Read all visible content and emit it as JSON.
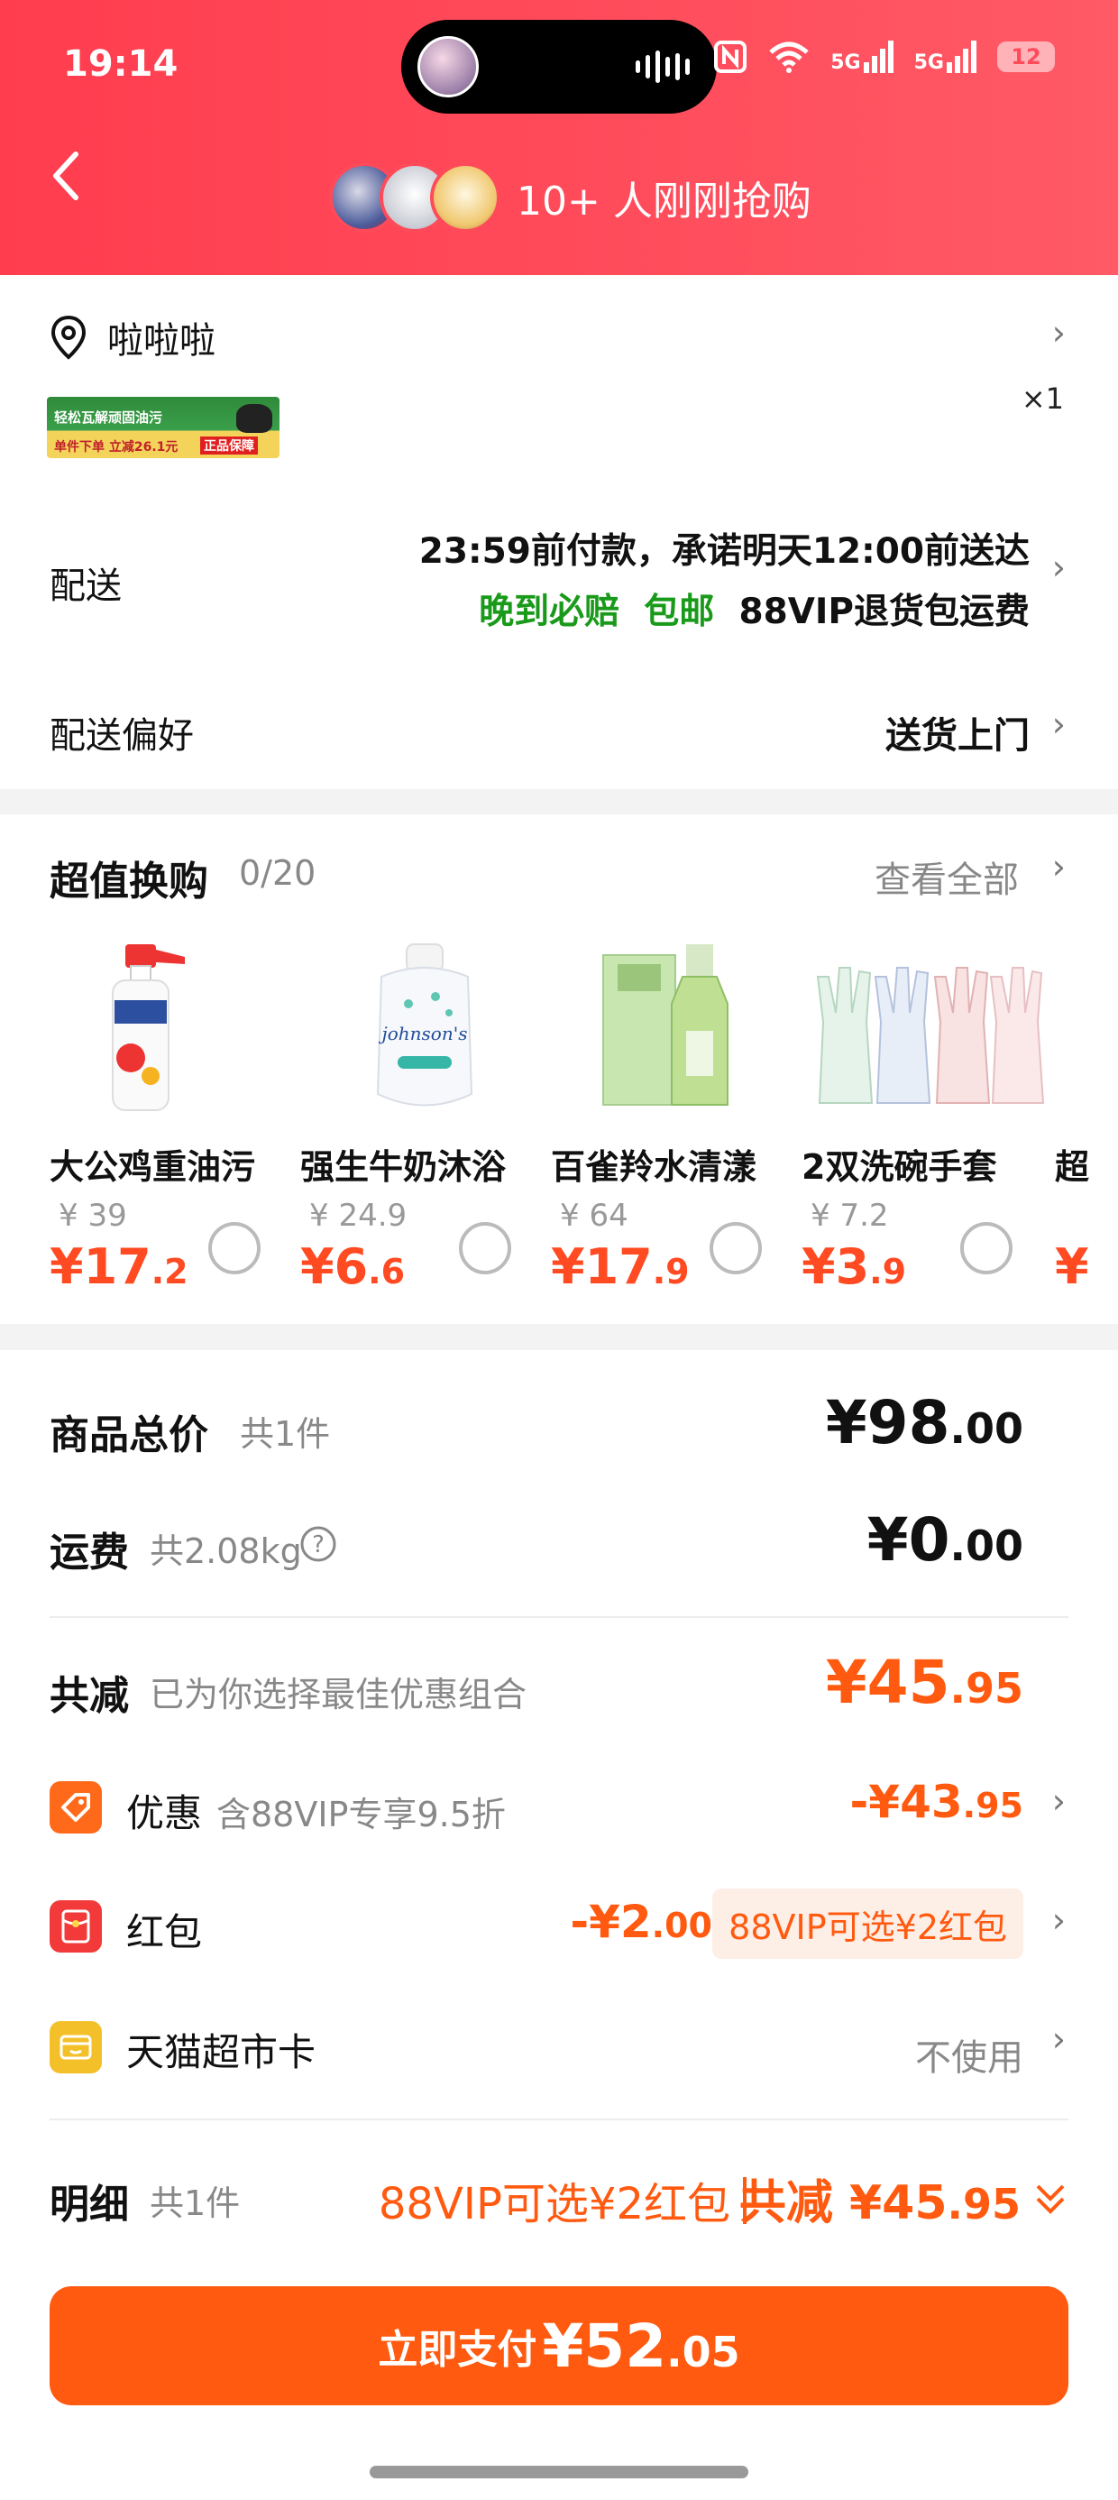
{
  "status_bar": {
    "time": "19:14",
    "signal1": "5G",
    "signal2": "5G",
    "battery": "12"
  },
  "header": {
    "recent_text": "10+ 人刚刚抢购"
  },
  "address": {
    "name": "啦啦啦"
  },
  "promo_banner": {
    "line1": "轻松瓦解顽固油污",
    "line2": "单件下单 立减26.1元",
    "badge": "正品保障"
  },
  "quantity": "×1",
  "delivery": {
    "label": "配送",
    "line1": "23:59前付款，承诺明天12:00前送达",
    "tag_late": "晚到必赔",
    "tag_free": "包邮",
    "tag_vip": "88VIP退货包运费"
  },
  "preference": {
    "label": "配送偏好",
    "value": "送货上门"
  },
  "swap": {
    "title": "超值换购",
    "count": "0/20",
    "view_all": "查看全部",
    "products": [
      {
        "name": "大公鸡重油污",
        "orig": "¥ 39",
        "price_int": "¥17",
        "price_dec": ".2"
      },
      {
        "name": "强生牛奶沐浴",
        "orig": "¥ 24.9",
        "price_int": "¥6",
        "price_dec": ".6"
      },
      {
        "name": "百雀羚水清漾",
        "orig": "¥ 64",
        "price_int": "¥17",
        "price_dec": ".9"
      },
      {
        "name": "2双洗碗手套",
        "orig": "¥ 7.2",
        "price_int": "¥3",
        "price_dec": ".9"
      }
    ]
  },
  "totals": {
    "goods_label": "商品总价",
    "goods_count": "共1件",
    "goods_int": "¥98",
    "goods_dec": ".00",
    "shipping_label": "运费",
    "shipping_weight": "共2.08kg",
    "shipping_int": "¥0",
    "shipping_dec": ".00",
    "discount_label": "共减",
    "discount_sub": "已为你选择最佳优惠组合",
    "discount_int": "¥45",
    "discount_dec": ".95",
    "promo_label": "优惠",
    "promo_sub": "含88VIP专享9.5折",
    "promo_int": "-¥43",
    "promo_dec": ".95",
    "redpacket_label": "红包",
    "redpacket_int": "-¥2",
    "redpacket_dec": ".00",
    "redpacket_pill": "88VIP可选¥2红包",
    "card_label": "天猫超市卡",
    "card_value": "不使用"
  },
  "detail": {
    "label": "明细",
    "count": "共1件",
    "vip_text": "88VIP可选¥2红包",
    "total_prefix": "共减 ",
    "total_int": "¥45",
    "total_dec": ".95"
  },
  "pay": {
    "label": "立即支付",
    "amount_int": "¥52",
    "amount_dec": ".05"
  },
  "colors": {
    "header": "#ff4a5a",
    "accent": "#ff5a10",
    "price": "#ff4a22",
    "green": "#1a9a1a"
  }
}
